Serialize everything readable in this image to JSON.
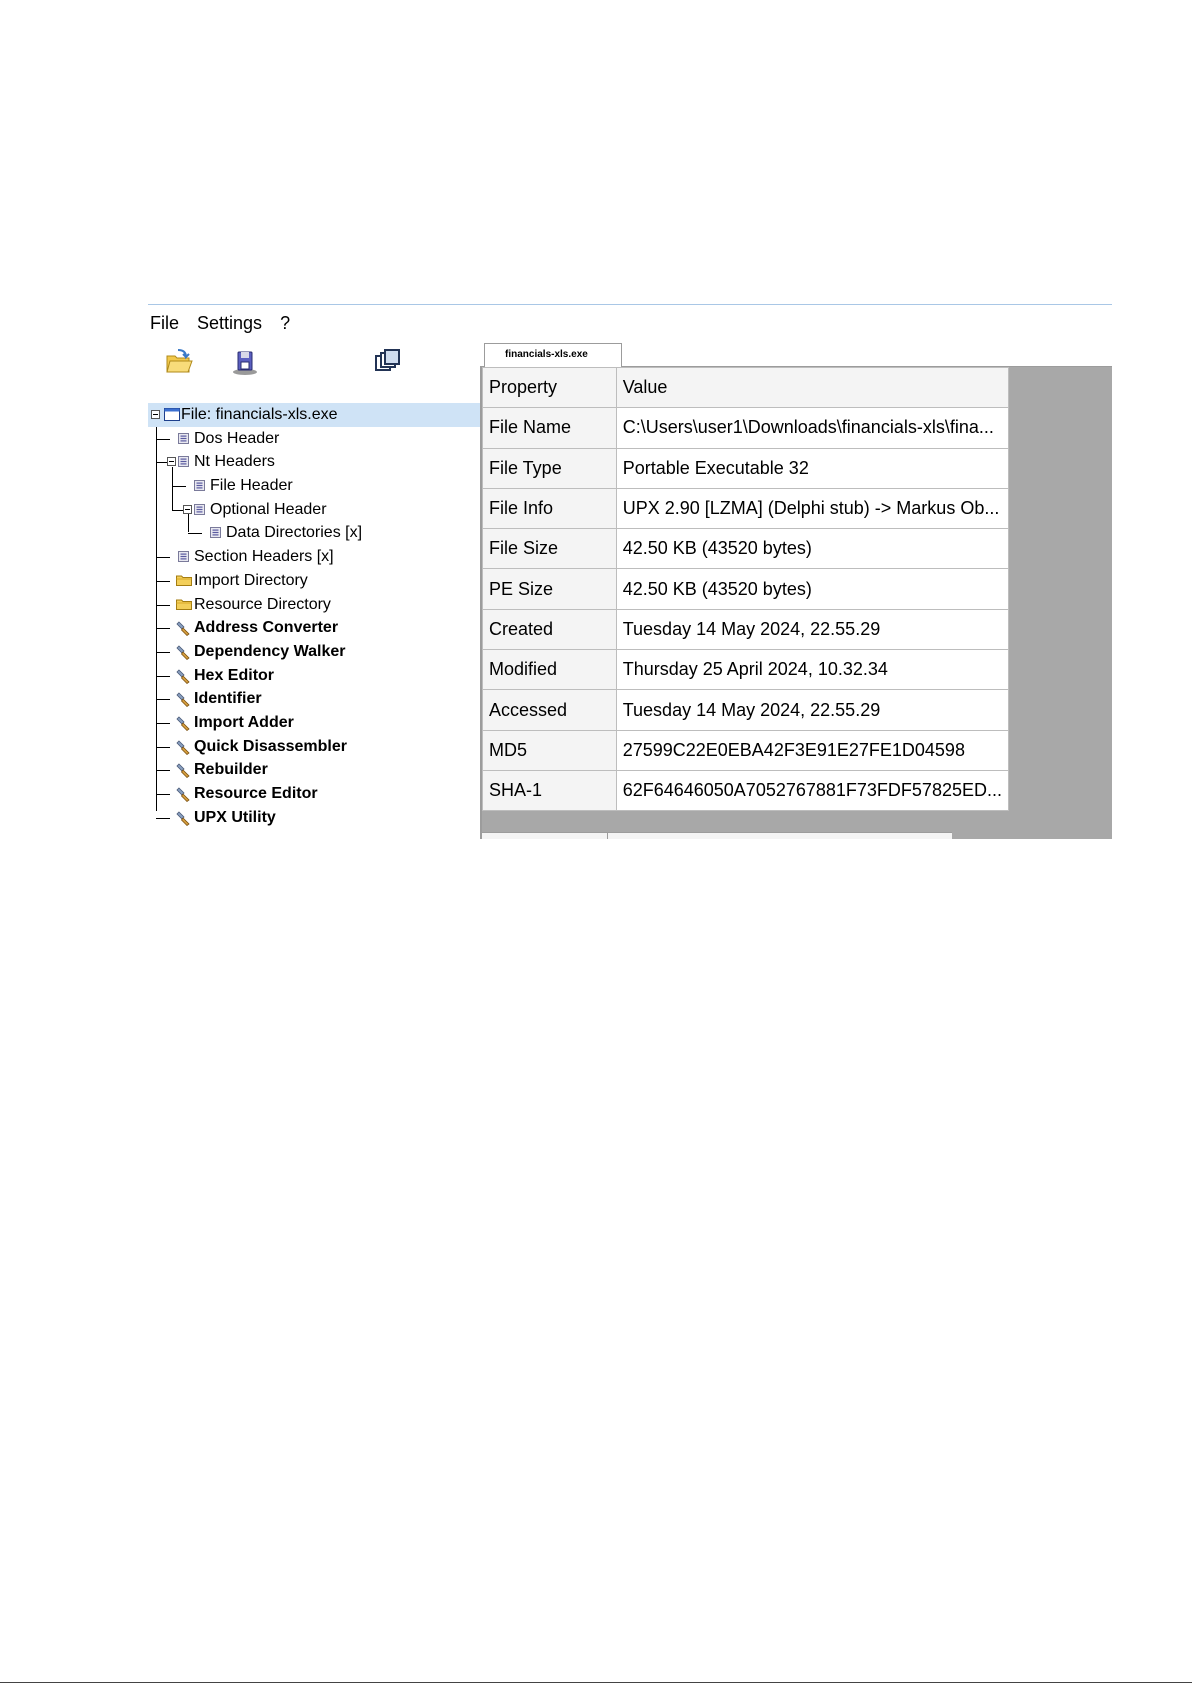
{
  "menu": [
    "File",
    "Settings",
    "?"
  ],
  "toolbar": {
    "icons": [
      "open-folder-icon",
      "save-disk-icon",
      "windows-icon"
    ]
  },
  "tree": {
    "root": "File: financials-xls.exe",
    "items": [
      "Dos Header",
      "Nt Headers",
      "File Header",
      "Optional Header",
      "Data Directories [x]",
      "Section Headers [x]",
      "Import Directory",
      "Resource Directory",
      "Address Converter",
      "Dependency Walker",
      "Hex Editor",
      "Identifier",
      "Import Adder",
      "Quick Disassembler",
      "Rebuilder",
      "Resource Editor",
      "UPX Utility"
    ]
  },
  "tab": {
    "label": "financials-xls.exe"
  },
  "table": {
    "headers": [
      "Property",
      "Value"
    ],
    "rows": [
      [
        "File Name",
        "C:\\Users\\user1\\Downloads\\financials-xls\\fina..."
      ],
      [
        "File Type",
        "Portable Executable 32"
      ],
      [
        "File Info",
        "UPX 2.90 [LZMA] (Delphi stub) -> Markus Ob..."
      ],
      [
        "File Size",
        "42.50 KB (43520 bytes)"
      ],
      [
        "PE Size",
        "42.50 KB (43520 bytes)"
      ],
      [
        "Created",
        "Tuesday 14 May 2024, 22.55.29"
      ],
      [
        "Modified",
        "Thursday 25 April 2024, 10.32.34"
      ],
      [
        "Accessed",
        "Tuesday 14 May 2024, 22.55.29"
      ],
      [
        "MD5",
        "27599C22E0EBA42F3E91E27FE1D04598"
      ],
      [
        "SHA-1",
        "62F64646050A7052767881F73FDF57825ED..."
      ]
    ]
  }
}
